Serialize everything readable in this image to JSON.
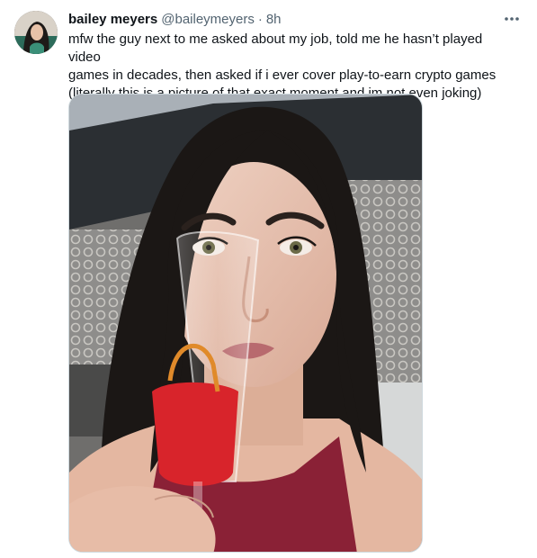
{
  "tweet": {
    "author": {
      "display_name": "bailey meyers",
      "handle": "@baileymeyers",
      "separator": "·",
      "timestamp": "8h",
      "avatar_icon": "user-avatar-photo"
    },
    "more_icon": "more-options-icon",
    "text_lines": [
      "mfw the guy next to me asked about my job, told me he hasn’t played video",
      "games in decades, then asked if i ever cover play-to-earn crypto games",
      "(literally this is a picture of that exact moment and im not even joking)"
    ],
    "media": {
      "type": "photo",
      "icon": "selfie-photo"
    }
  },
  "colors": {
    "text_primary": "#0f1419",
    "text_secondary": "#536471",
    "border": "#cfd9de",
    "drink_red": "#d8242b",
    "top_maroon": "#8a2136"
  }
}
